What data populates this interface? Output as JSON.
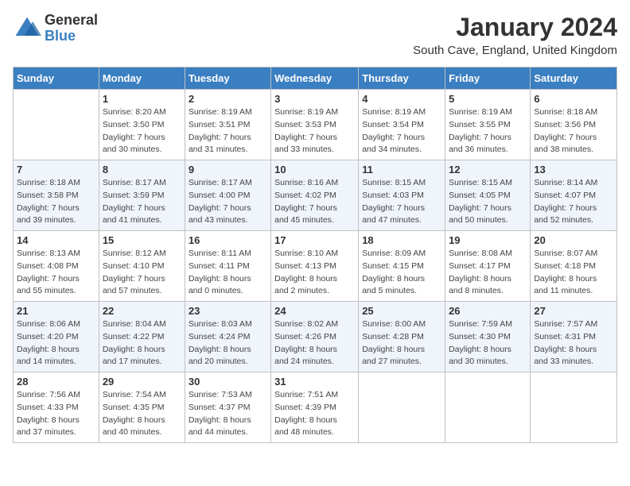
{
  "logo": {
    "general": "General",
    "blue": "Blue"
  },
  "title": "January 2024",
  "location": "South Cave, England, United Kingdom",
  "days_of_week": [
    "Sunday",
    "Monday",
    "Tuesday",
    "Wednesday",
    "Thursday",
    "Friday",
    "Saturday"
  ],
  "weeks": [
    [
      {
        "day": "",
        "info": ""
      },
      {
        "day": "1",
        "info": "Sunrise: 8:20 AM\nSunset: 3:50 PM\nDaylight: 7 hours\nand 30 minutes."
      },
      {
        "day": "2",
        "info": "Sunrise: 8:19 AM\nSunset: 3:51 PM\nDaylight: 7 hours\nand 31 minutes."
      },
      {
        "day": "3",
        "info": "Sunrise: 8:19 AM\nSunset: 3:53 PM\nDaylight: 7 hours\nand 33 minutes."
      },
      {
        "day": "4",
        "info": "Sunrise: 8:19 AM\nSunset: 3:54 PM\nDaylight: 7 hours\nand 34 minutes."
      },
      {
        "day": "5",
        "info": "Sunrise: 8:19 AM\nSunset: 3:55 PM\nDaylight: 7 hours\nand 36 minutes."
      },
      {
        "day": "6",
        "info": "Sunrise: 8:18 AM\nSunset: 3:56 PM\nDaylight: 7 hours\nand 38 minutes."
      }
    ],
    [
      {
        "day": "7",
        "info": "Sunrise: 8:18 AM\nSunset: 3:58 PM\nDaylight: 7 hours\nand 39 minutes."
      },
      {
        "day": "8",
        "info": "Sunrise: 8:17 AM\nSunset: 3:59 PM\nDaylight: 7 hours\nand 41 minutes."
      },
      {
        "day": "9",
        "info": "Sunrise: 8:17 AM\nSunset: 4:00 PM\nDaylight: 7 hours\nand 43 minutes."
      },
      {
        "day": "10",
        "info": "Sunrise: 8:16 AM\nSunset: 4:02 PM\nDaylight: 7 hours\nand 45 minutes."
      },
      {
        "day": "11",
        "info": "Sunrise: 8:15 AM\nSunset: 4:03 PM\nDaylight: 7 hours\nand 47 minutes."
      },
      {
        "day": "12",
        "info": "Sunrise: 8:15 AM\nSunset: 4:05 PM\nDaylight: 7 hours\nand 50 minutes."
      },
      {
        "day": "13",
        "info": "Sunrise: 8:14 AM\nSunset: 4:07 PM\nDaylight: 7 hours\nand 52 minutes."
      }
    ],
    [
      {
        "day": "14",
        "info": "Sunrise: 8:13 AM\nSunset: 4:08 PM\nDaylight: 7 hours\nand 55 minutes."
      },
      {
        "day": "15",
        "info": "Sunrise: 8:12 AM\nSunset: 4:10 PM\nDaylight: 7 hours\nand 57 minutes."
      },
      {
        "day": "16",
        "info": "Sunrise: 8:11 AM\nSunset: 4:11 PM\nDaylight: 8 hours\nand 0 minutes."
      },
      {
        "day": "17",
        "info": "Sunrise: 8:10 AM\nSunset: 4:13 PM\nDaylight: 8 hours\nand 2 minutes."
      },
      {
        "day": "18",
        "info": "Sunrise: 8:09 AM\nSunset: 4:15 PM\nDaylight: 8 hours\nand 5 minutes."
      },
      {
        "day": "19",
        "info": "Sunrise: 8:08 AM\nSunset: 4:17 PM\nDaylight: 8 hours\nand 8 minutes."
      },
      {
        "day": "20",
        "info": "Sunrise: 8:07 AM\nSunset: 4:18 PM\nDaylight: 8 hours\nand 11 minutes."
      }
    ],
    [
      {
        "day": "21",
        "info": "Sunrise: 8:06 AM\nSunset: 4:20 PM\nDaylight: 8 hours\nand 14 minutes."
      },
      {
        "day": "22",
        "info": "Sunrise: 8:04 AM\nSunset: 4:22 PM\nDaylight: 8 hours\nand 17 minutes."
      },
      {
        "day": "23",
        "info": "Sunrise: 8:03 AM\nSunset: 4:24 PM\nDaylight: 8 hours\nand 20 minutes."
      },
      {
        "day": "24",
        "info": "Sunrise: 8:02 AM\nSunset: 4:26 PM\nDaylight: 8 hours\nand 24 minutes."
      },
      {
        "day": "25",
        "info": "Sunrise: 8:00 AM\nSunset: 4:28 PM\nDaylight: 8 hours\nand 27 minutes."
      },
      {
        "day": "26",
        "info": "Sunrise: 7:59 AM\nSunset: 4:30 PM\nDaylight: 8 hours\nand 30 minutes."
      },
      {
        "day": "27",
        "info": "Sunrise: 7:57 AM\nSunset: 4:31 PM\nDaylight: 8 hours\nand 33 minutes."
      }
    ],
    [
      {
        "day": "28",
        "info": "Sunrise: 7:56 AM\nSunset: 4:33 PM\nDaylight: 8 hours\nand 37 minutes."
      },
      {
        "day": "29",
        "info": "Sunrise: 7:54 AM\nSunset: 4:35 PM\nDaylight: 8 hours\nand 40 minutes."
      },
      {
        "day": "30",
        "info": "Sunrise: 7:53 AM\nSunset: 4:37 PM\nDaylight: 8 hours\nand 44 minutes."
      },
      {
        "day": "31",
        "info": "Sunrise: 7:51 AM\nSunset: 4:39 PM\nDaylight: 8 hours\nand 48 minutes."
      },
      {
        "day": "",
        "info": ""
      },
      {
        "day": "",
        "info": ""
      },
      {
        "day": "",
        "info": ""
      }
    ]
  ]
}
